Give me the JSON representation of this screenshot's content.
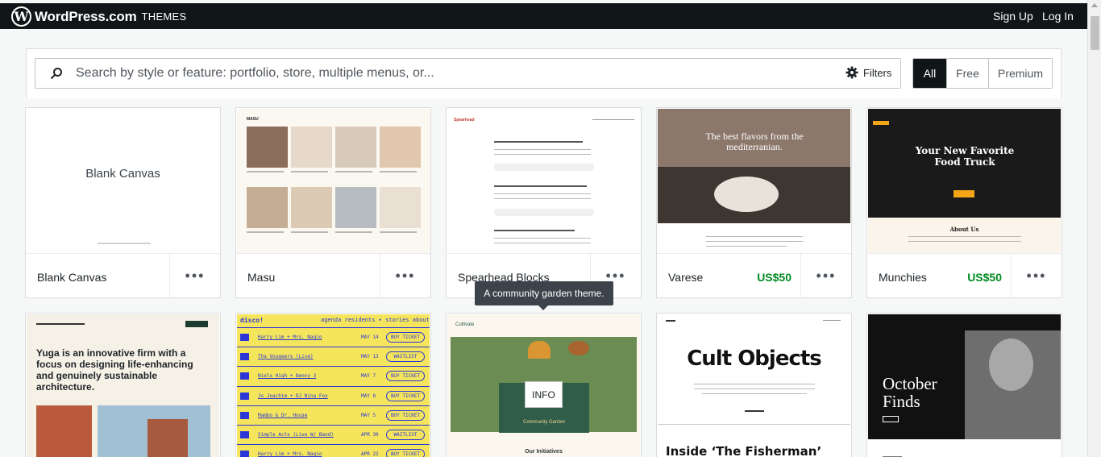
{
  "header": {
    "logo_text": "WordPress.com",
    "logo_sub": "THEMES",
    "signup_label": "Sign Up",
    "login_label": "Log In"
  },
  "search": {
    "placeholder": "Search by style or feature: portfolio, store, multiple menus, or...",
    "filters_label": "Filters"
  },
  "tier_tabs": [
    {
      "label": "All",
      "active": true
    },
    {
      "label": "Free",
      "active": false
    },
    {
      "label": "Premium",
      "active": false
    }
  ],
  "themes": [
    {
      "name": "Blank Canvas",
      "price": "",
      "thumb_title": "Blank Canvas"
    },
    {
      "name": "Masu",
      "price": "",
      "thumb_title": "MASU"
    },
    {
      "name": "Spearhead Blocks",
      "price": "",
      "thumb_title": "Spearhead"
    },
    {
      "name": "Varese",
      "price": "US$50",
      "thumb_title": "The best flavors from the mediterranian."
    },
    {
      "name": "Munchies",
      "price": "US$50",
      "thumb_title": "Your New Favorite Food Truck",
      "thumb_sub": "About Us"
    },
    {
      "name": "Yuga",
      "price": "",
      "thumb_title": "Yuga is an innovative firm with a focus on designing life-enhancing and genuinely sustainable architecture."
    },
    {
      "name": "Disco",
      "price": "",
      "thumb_title": "disco!",
      "thumb_nav": "agenda   residents ▾   stories   about",
      "gigs": [
        {
          "artist": "Harry Lim + Mrs. Nagio",
          "date": "MAY 14",
          "status": "BUY TICKET"
        },
        {
          "artist": "The Vougeers (Live)",
          "date": "MAY 13",
          "status": "WAITLIST"
        },
        {
          "artist": "Niels High + Benny 3",
          "date": "MAY 7",
          "status": "BUY TICKET"
        },
        {
          "artist": "Jo Joachim + DJ Nina Fox",
          "date": "MAY 8",
          "status": "BUY TICKET"
        },
        {
          "artist": "Mambo & Dr. House",
          "date": "MAY 5",
          "status": "BUY TICKET"
        },
        {
          "artist": "Simple Acts (Live W/ Band)",
          "date": "APR 30",
          "status": "WAITLIST"
        },
        {
          "artist": "Harry Lim + Mrs. Nagio",
          "date": "APR 22",
          "status": "BUY TICKET"
        }
      ]
    },
    {
      "name": "Cultivate",
      "price": "",
      "thumb_title": "Cultivate",
      "thumb_sub": "Community Garden",
      "thumb_footer": "Our Initiatives"
    },
    {
      "name": "Cult Objects",
      "price": "",
      "thumb_title": "Cult Objects",
      "thumb_sub": "Inside ‘The Fisherman’"
    },
    {
      "name": "October Finds",
      "price": "",
      "thumb_title": "October Finds"
    }
  ],
  "tooltip": "A community garden theme.",
  "info_label": "INFO",
  "more_label": "•••",
  "colors": {
    "topbar": "#101517",
    "price": "#008a20",
    "munchies_bg": "#1a1a1a",
    "munchies_accent": "#f2a516",
    "disco_yellow": "#f4e55c",
    "disco_blue": "#2b36d9",
    "cultivate_green": "#2f5d4a"
  }
}
